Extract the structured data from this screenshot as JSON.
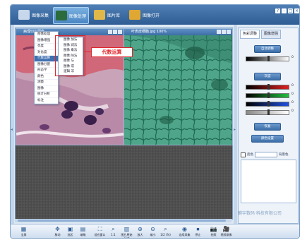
{
  "colors": {
    "toolbar_blue": "#2e5c93",
    "accent_red": "#e0262b",
    "panel_bg": "#eef3f9"
  },
  "top_toolbar": {
    "buttons": [
      {
        "label": "图像采集",
        "icon": "camera-icon",
        "active": false
      },
      {
        "label": "图像处理",
        "icon": "image-process-icon",
        "active": true
      },
      {
        "label": "图片库",
        "icon": "gallery-icon",
        "active": false
      },
      {
        "label": "图像打开",
        "icon": "folder-open-icon",
        "active": false
      }
    ],
    "window_controls": [
      "?",
      "-",
      "□",
      "×"
    ]
  },
  "image_windows": [
    {
      "title": "病理切片图像",
      "kind": "tissue-stain-image"
    },
    {
      "title": "叶表皮细胞.jpg 100%",
      "kind": "leaf-epidermis-image"
    }
  ],
  "menu": {
    "items": [
      "图像处理",
      "图像增强",
      "亮度",
      "对比度",
      "代数运算",
      "图像分割",
      "形态学",
      "颜色",
      "测量",
      "图像",
      "统计分析",
      "标注"
    ],
    "selected_index": 4
  },
  "submenu": {
    "items": [
      "图像 加法",
      "图像 减法",
      "图像 乘法",
      "图像 除法",
      "图像 与",
      "图像 或",
      "逻辑 非"
    ]
  },
  "callout": {
    "text": "代数运算"
  },
  "right_panel": {
    "tabs": [
      "色彩调整",
      "图像增强"
    ],
    "active_tab": 0,
    "auto_button": "自动调整",
    "gray_button": "灰度",
    "bar_values": [
      "0",
      "0",
      "0",
      "0",
      "0"
    ],
    "reset_button": "恢复",
    "advanced_button": "颜色设置",
    "checkbox_label": "反色",
    "select_label": "背景色"
  },
  "bottom_toolbar": {
    "buttons": [
      {
        "label": "全屏",
        "icon": "grid-icon"
      },
      {
        "label": "移动",
        "icon": "move-icon"
      },
      {
        "label": "选区",
        "icon": "select-icon"
      },
      {
        "label": "缩略",
        "icon": "thumb-icon"
      },
      {
        "label": "适应窗口",
        "icon": "fit-icon"
      },
      {
        "label": "1:1",
        "icon": "actual-size-icon"
      },
      {
        "label": "图片原始尺寸",
        "icon": "original-icon"
      },
      {
        "label": "放大",
        "icon": "zoom-in-icon"
      },
      {
        "label": "缩小",
        "icon": "zoom-out-icon"
      },
      {
        "label": "1/2 (%)",
        "icon": "zoom-half-icon"
      },
      {
        "label": "连续采集",
        "icon": "continuous-capture-icon"
      },
      {
        "label": "停止",
        "icon": "stop-icon"
      },
      {
        "label": "拍照",
        "icon": "snapshot-icon"
      },
      {
        "label": "视频录像",
        "icon": "record-icon"
      }
    ]
  },
  "watermark": {
    "text": "麒宇数码·科技有限公司"
  }
}
